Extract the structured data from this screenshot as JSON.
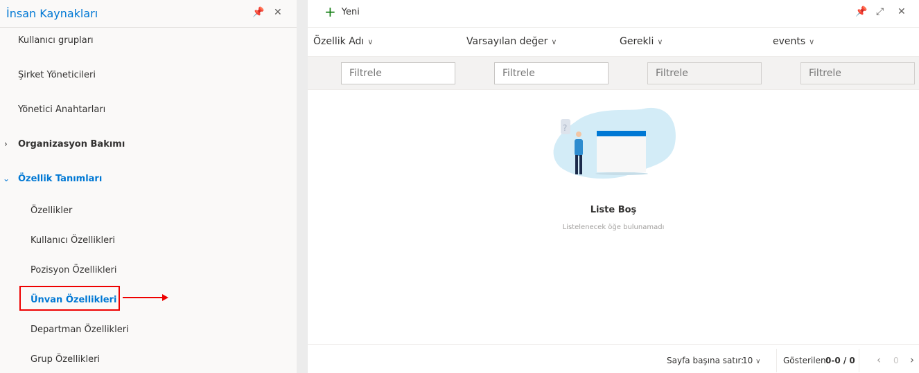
{
  "sidebar": {
    "title": "İnsan Kaynakları",
    "items": [
      {
        "label": "Kullanıcı grupları"
      },
      {
        "label": "Şirket Yöneticileri"
      },
      {
        "label": "Yönetici Anahtarları"
      },
      {
        "label": "Organizasyon Bakımı",
        "expanded": false
      },
      {
        "label": "Özellik Tanımları",
        "expanded": true
      },
      {
        "label": "Özellikler"
      },
      {
        "label": "Kullanıcı Özellikleri"
      },
      {
        "label": "Pozisyon Özellikleri"
      },
      {
        "label": "Ünvan Özellikleri",
        "selected": true
      },
      {
        "label": "Departman Özellikleri"
      },
      {
        "label": "Grup Özellikleri"
      }
    ]
  },
  "toolbar": {
    "new_label": "Yeni"
  },
  "columns": [
    {
      "label": "Özellik Adı"
    },
    {
      "label": "Varsayılan değer"
    },
    {
      "label": "Gerekli"
    },
    {
      "label": "events"
    }
  ],
  "filters": {
    "placeholder": "Filtrele"
  },
  "empty": {
    "title": "Liste Boş",
    "subtitle": "Listelenecek öğe bulunamadı"
  },
  "footer": {
    "rows_label": "Sayfa başına satır:",
    "rows_value": "10",
    "shown_label": "Gösterilen:",
    "shown_value": "0-0 / 0",
    "page": "0"
  },
  "colors": {
    "accent": "#0078d4",
    "highlight": "#e00000"
  }
}
